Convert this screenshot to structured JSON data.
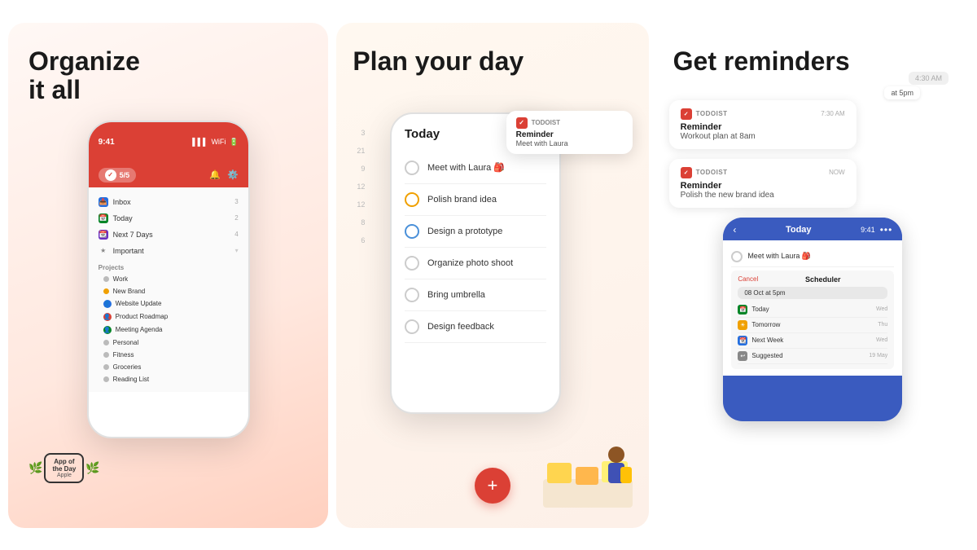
{
  "panel1": {
    "title": "Organize\nit all",
    "phone": {
      "time": "9:41",
      "menu": {
        "inbox": {
          "label": "Inbox",
          "count": "3"
        },
        "today": {
          "label": "Today",
          "count": "2"
        },
        "next7": {
          "label": "Next 7 Days",
          "count": "4"
        },
        "important": {
          "label": "Important"
        }
      },
      "sections": {
        "projects": "Projects"
      },
      "projects": [
        {
          "label": "Work",
          "color": "#bbb"
        },
        {
          "label": "New Brand",
          "color": "#f0a000"
        },
        {
          "label": "Website Update",
          "color": "#246fe0",
          "icon": "person"
        },
        {
          "label": "Product Roadmap",
          "color": "#db4035",
          "icon": "person"
        },
        {
          "label": "Meeting Agenda",
          "color": "#058527",
          "icon": "person"
        },
        {
          "label": "Personal",
          "color": "#bbb"
        },
        {
          "label": "Fitness",
          "color": "#bbb"
        },
        {
          "label": "Groceries",
          "color": "#bbb"
        },
        {
          "label": "Reading List",
          "color": "#bbb"
        }
      ],
      "badge_score": "5/5",
      "today_label": "Today"
    },
    "badge": {
      "line1": "App of",
      "line2": "the Day",
      "line3": "Apple"
    }
  },
  "panel2": {
    "title": "Plan your day",
    "tasks_title": "Today",
    "tasks": [
      {
        "label": "Meet with Laura 🎒",
        "circle_color": "default"
      },
      {
        "label": "Polish brand idea",
        "circle_color": "orange"
      },
      {
        "label": "Design a prototype",
        "circle_color": "blue"
      },
      {
        "label": "Organize photo shoot",
        "circle_color": "default"
      },
      {
        "label": "Bring umbrella",
        "circle_color": "default"
      },
      {
        "label": "Design feedback",
        "circle_color": "default"
      }
    ],
    "fab_label": "+",
    "notification": {
      "app_name": "TODOIST",
      "title": "Reminder",
      "body": "Meet with Laura"
    },
    "calendar_numbers": [
      "3",
      "21",
      "9",
      "12",
      "12",
      "8",
      "6"
    ],
    "time_label": "at 5pm"
  },
  "panel3": {
    "title": "Get reminders",
    "reminders": [
      {
        "app_name": "TODOIST",
        "time": "7:30 AM",
        "title": "Reminder",
        "body": "Workout plan at 8am"
      },
      {
        "app_name": "TODOIST",
        "time": "NOW",
        "title": "Reminder",
        "body": "Polish the new brand idea"
      }
    ],
    "phone": {
      "time": "9:41",
      "title": "Today",
      "task": "Meet with Laura 🎒",
      "scheduler": {
        "cancel": "Cancel",
        "label": "Scheduler",
        "date": "08 Oct at 5pm",
        "options": [
          {
            "label": "Today",
            "day": "Wed",
            "icon_color": "#058527"
          },
          {
            "label": "Tomorrow",
            "day": "Thu",
            "icon_color": "#f0a000"
          },
          {
            "label": "Next Week",
            "day": "Wed",
            "icon_color": "#246fe0"
          },
          {
            "label": "Suggested",
            "day": "19 May",
            "icon_color": "#888"
          }
        ]
      }
    }
  }
}
